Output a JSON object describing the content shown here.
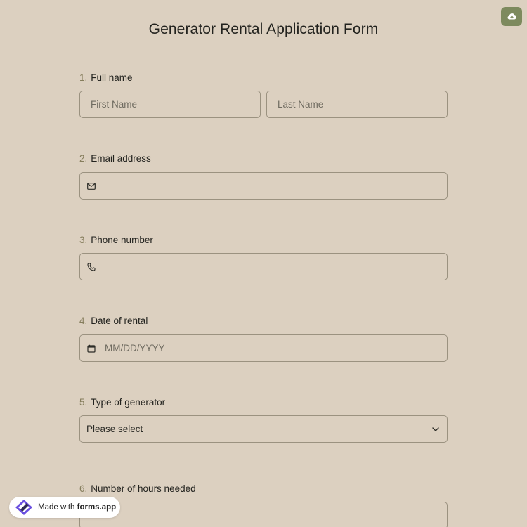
{
  "form": {
    "title": "Generator Rental Application Form"
  },
  "toolbar": {
    "save_icon": "cloud-upload-icon"
  },
  "questions": [
    {
      "number": "1.",
      "label": "Full name",
      "first_placeholder": "First Name",
      "last_placeholder": "Last Name"
    },
    {
      "number": "2.",
      "label": "Email address",
      "icon": "envelope-icon",
      "value": ""
    },
    {
      "number": "3.",
      "label": "Phone number",
      "icon": "phone-icon",
      "value": ""
    },
    {
      "number": "4.",
      "label": "Date of rental",
      "icon": "calendar-icon",
      "placeholder": "MM/DD/YYYY"
    },
    {
      "number": "5.",
      "label": "Type of generator",
      "selected": "Please select",
      "icon": "chevron-down-icon"
    },
    {
      "number": "6.",
      "label": "Number of hours needed"
    }
  ],
  "badge": {
    "prefix": "Made with ",
    "brand": "forms.app"
  },
  "colors": {
    "background": "#dcd0c0",
    "accent": "#7d8a5e",
    "number": "#857d5c",
    "border": "#9b9280"
  }
}
